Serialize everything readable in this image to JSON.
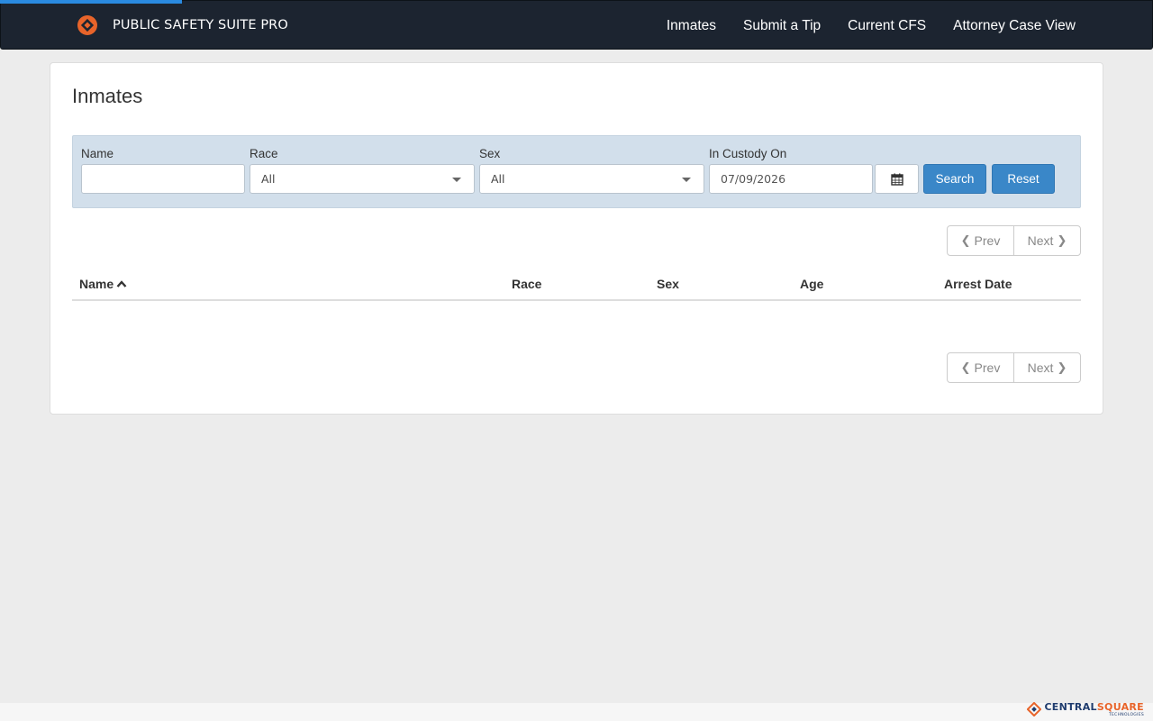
{
  "app": {
    "brand_name": "PUBLIC SAFETY SUITE PRO",
    "brand_color": "#e8642a",
    "nav_bg": "#1c2430",
    "accent": "#3a87c8"
  },
  "nav": {
    "items": [
      {
        "label": "Inmates"
      },
      {
        "label": "Submit a Tip"
      },
      {
        "label": "Current CFS"
      },
      {
        "label": "Attorney Case View"
      }
    ]
  },
  "page": {
    "title": "Inmates"
  },
  "filters": {
    "name_label": "Name",
    "name_value": "",
    "race_label": "Race",
    "race_value": "All",
    "sex_label": "Sex",
    "sex_value": "All",
    "custody_label": "In Custody On",
    "custody_value": "07/09/2026",
    "calendar_icon": "calendar-icon",
    "search_label": "Search",
    "reset_label": "Reset"
  },
  "pager": {
    "prev_label": "Prev",
    "next_label": "Next"
  },
  "table": {
    "columns": [
      {
        "label": "Name",
        "sort": "ascending"
      },
      {
        "label": "Race"
      },
      {
        "label": "Sex"
      },
      {
        "label": "Age"
      },
      {
        "label": "Arrest Date"
      }
    ],
    "rows": []
  },
  "footer": {
    "logo_part1": "CENTRAL",
    "logo_part2": "SQUARE",
    "logo_sub": "TECHNOLOGIES"
  }
}
